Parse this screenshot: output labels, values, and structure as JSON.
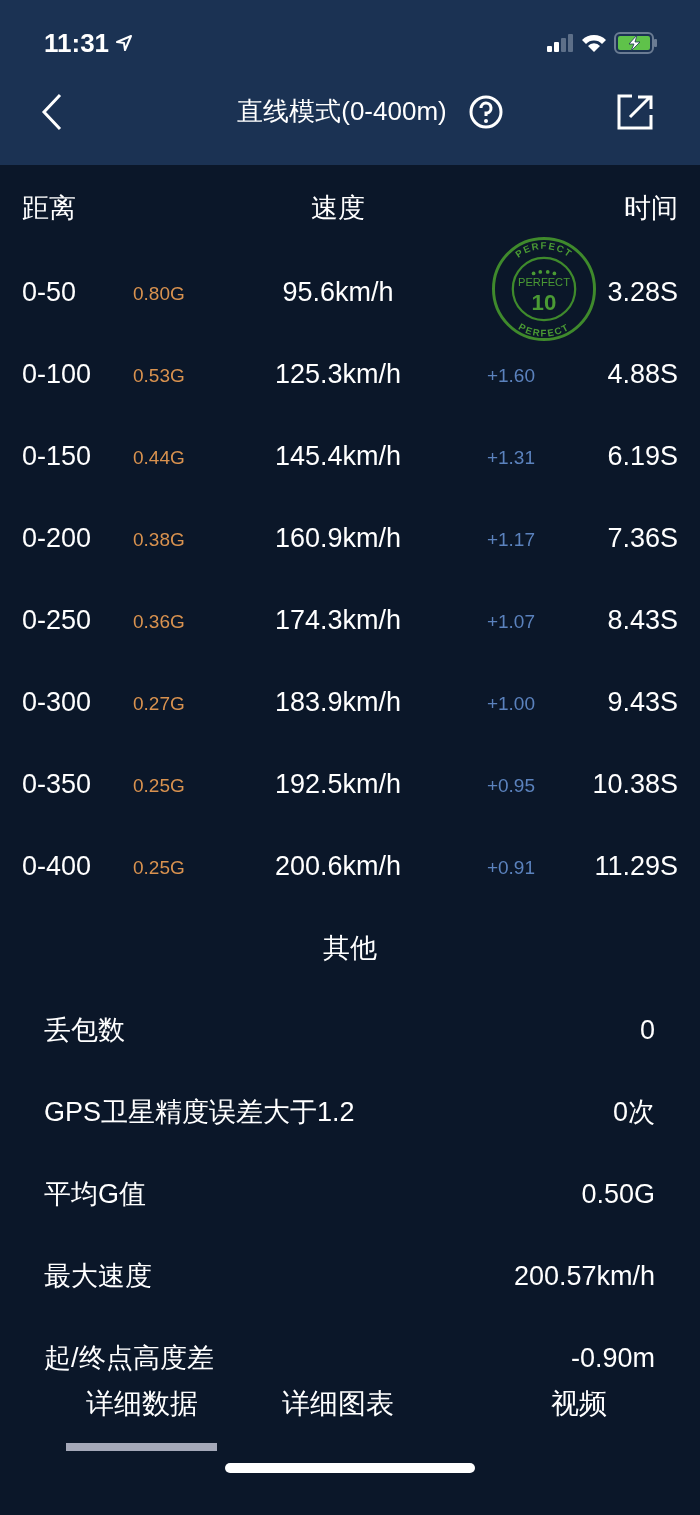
{
  "status_bar": {
    "time": "11:31"
  },
  "nav": {
    "title": "直线模式(0-400m)"
  },
  "table": {
    "columns": [
      "距离",
      "速度",
      "时间"
    ],
    "rows": [
      {
        "distance": "0-50",
        "g": "0.80G",
        "speed": "95.6km/h",
        "time": "3.28S"
      },
      {
        "distance": "0-100",
        "g": "0.53G",
        "speed": "125.3km/h",
        "delta": "+1.60",
        "time": "4.88S"
      },
      {
        "distance": "0-150",
        "g": "0.44G",
        "speed": "145.4km/h",
        "delta": "+1.31",
        "time": "6.19S"
      },
      {
        "distance": "0-200",
        "g": "0.38G",
        "speed": "160.9km/h",
        "delta": "+1.17",
        "time": "7.36S"
      },
      {
        "distance": "0-250",
        "g": "0.36G",
        "speed": "174.3km/h",
        "delta": "+1.07",
        "time": "8.43S"
      },
      {
        "distance": "0-300",
        "g": "0.27G",
        "speed": "183.9km/h",
        "delta": "+1.00",
        "time": "9.43S"
      },
      {
        "distance": "0-350",
        "g": "0.25G",
        "speed": "192.5km/h",
        "delta": "+0.95",
        "time": "10.38S"
      },
      {
        "distance": "0-400",
        "g": "0.25G",
        "speed": "200.6km/h",
        "delta": "+0.91",
        "time": "11.29S"
      }
    ]
  },
  "stamp": {
    "ring_top": "PERFECT",
    "ring_bottom": "PERFECT",
    "inner_text": "PERFECT",
    "score": "10"
  },
  "other": {
    "title": "其他",
    "rows": [
      {
        "label": "丢包数",
        "value": "0"
      },
      {
        "label": "GPS卫星精度误差大于1.2",
        "value": "0次"
      },
      {
        "label": "平均G值",
        "value": "0.50G"
      },
      {
        "label": "最大速度",
        "value": "200.57km/h"
      },
      {
        "label": "起/终点高度差",
        "value": "-0.90m"
      }
    ]
  },
  "tabs": [
    {
      "label": "详细数据",
      "selected": true
    },
    {
      "label": "详细图表",
      "selected": false
    },
    {
      "label": "视频",
      "selected": false
    }
  ]
}
